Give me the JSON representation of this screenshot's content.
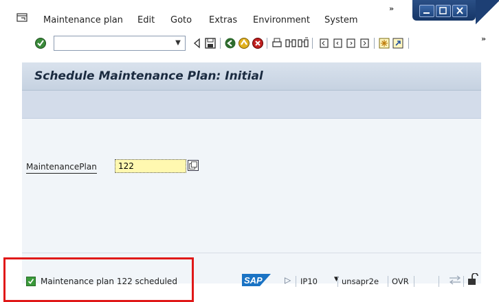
{
  "menubar": {
    "items": [
      "Maintenance plan",
      "Edit",
      "Goto",
      "Extras",
      "Environment",
      "System"
    ],
    "more": "»"
  },
  "toolbar": {
    "command_value": "",
    "more": "»",
    "icons": [
      "enter-icon",
      "back-arrow-icon",
      "save-icon",
      "back-icon",
      "exit-icon",
      "cancel-icon",
      "print-icon",
      "find-icon",
      "find-next-icon",
      "first-page-icon",
      "previous-page-icon",
      "next-page-icon",
      "last-page-icon",
      "create-session-icon",
      "shortcut-icon"
    ]
  },
  "title": "Schedule Maintenance Plan: Initial",
  "form": {
    "maintenance_plan_label": "MaintenancePlan",
    "maintenance_plan_value": "122"
  },
  "status": {
    "message": "Maintenance plan 122 scheduled",
    "system": "IP10",
    "host": "unsapr2e",
    "mode": "OVR"
  },
  "colors": {
    "accent": "#163667",
    "title_panel": "#d9e2ed",
    "input_highlight": "#fff8b0",
    "highlight_box": "#e01818",
    "success": "#3a9a3a"
  }
}
